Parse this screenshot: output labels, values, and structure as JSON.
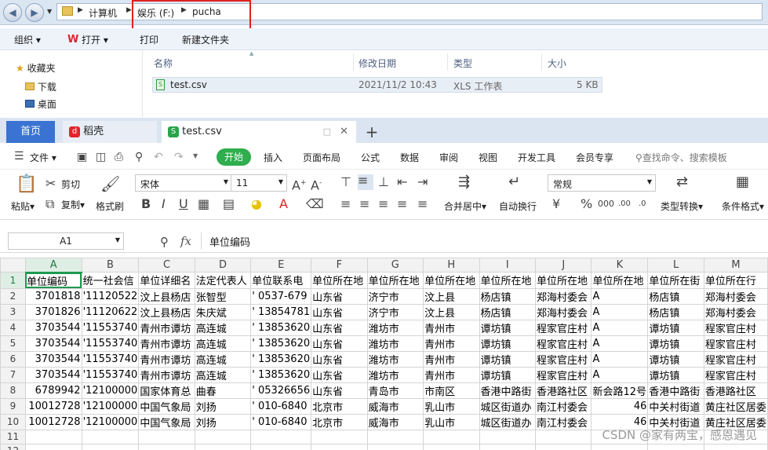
{
  "explorer": {
    "back_icon": "back-arrow-icon",
    "forward_icon": "forward-arrow-icon",
    "breadcrumb": [
      "计算机",
      "娱乐 (F:)",
      "pucha"
    ],
    "commands": [
      "组织",
      "打开",
      "打印",
      "新建文件夹"
    ],
    "nav": [
      {
        "label": "收藏夹",
        "icon": "star-icon"
      },
      {
        "label": "下载",
        "icon": "download-folder-icon"
      },
      {
        "label": "桌面",
        "icon": "desktop-icon"
      }
    ],
    "columns": [
      "名称",
      "修改日期",
      "类型",
      "大小"
    ],
    "file": {
      "name": "test.csv",
      "modified": "2021/11/2 10:43",
      "type": "XLS 工作表",
      "size": "5 KB"
    }
  },
  "wps": {
    "tabs": [
      {
        "label": "首页"
      },
      {
        "label": "稻壳"
      },
      {
        "label": "test.csv"
      }
    ],
    "add_tab": "+",
    "menu": [
      "文件",
      "开始",
      "插入",
      "页面布局",
      "公式",
      "数据",
      "审阅",
      "视图",
      "开发工具",
      "会员专享"
    ],
    "search_placeholder": "查找命令、搜索模板",
    "ribbon": {
      "paste": "粘贴",
      "cut": "剪切",
      "copy": "复制",
      "format_painter": "格式刷",
      "font_name": "宋体",
      "font_size": "11",
      "merge": "合并居中",
      "wrap": "自动换行",
      "number_format": "常规",
      "convert": "类型转换",
      "cond_format": "条件格式"
    },
    "formula": {
      "cell_ref": "A1",
      "fx": "fx",
      "content": "单位编码"
    }
  },
  "sheet": {
    "columns": [
      "A",
      "B",
      "C",
      "D",
      "E",
      "F",
      "G",
      "H",
      "I",
      "J",
      "K",
      "L",
      "M"
    ],
    "rows": [
      [
        "单位编码",
        "统一社会信",
        "单位详细名",
        "法定代表人",
        "单位联系电",
        "单位所在地",
        "单位所在地",
        "单位所在地",
        "单位所在地",
        "单位所在地",
        "单位所在地",
        "单位所在街",
        "单位所在行"
      ],
      [
        "3701818",
        "'11120522",
        "汶上县杨店",
        "张智型",
        "' 0537-679",
        "山东省",
        "济宁市",
        "汶上县",
        "杨店镇",
        "郑海村委会",
        "A",
        "杨店镇",
        "郑海村委会"
      ],
      [
        "3701826",
        "'11120622",
        "汶上县杨店",
        "朱庆斌",
        "' 13854781",
        "山东省",
        "济宁市",
        "汶上县",
        "杨店镇",
        "郑海村委会",
        "A",
        "杨店镇",
        "郑海村委会"
      ],
      [
        "3703544",
        "'11553740",
        "青州市谭坊",
        "高连城",
        "' 13853620",
        "山东省",
        "潍坊市",
        "青州市",
        "谭坊镇",
        "程家官庄村",
        "A",
        "谭坊镇",
        "程家官庄村"
      ],
      [
        "3703544",
        "'11553740",
        "青州市谭坊",
        "高连城",
        "' 13853620",
        "山东省",
        "潍坊市",
        "青州市",
        "谭坊镇",
        "程家官庄村",
        "A",
        "谭坊镇",
        "程家官庄村"
      ],
      [
        "3703544",
        "'11553740",
        "青州市谭坊",
        "高连城",
        "' 13853620",
        "山东省",
        "潍坊市",
        "青州市",
        "谭坊镇",
        "程家官庄村",
        "A",
        "谭坊镇",
        "程家官庄村"
      ],
      [
        "3703544",
        "'11553740",
        "青州市谭坊",
        "高连城",
        "' 13853620",
        "山东省",
        "潍坊市",
        "青州市",
        "谭坊镇",
        "程家官庄村",
        "A",
        "谭坊镇",
        "程家官庄村"
      ],
      [
        "6789942",
        "'12100000",
        "国家体育总",
        "曲春",
        "' 05326656",
        "山东省",
        "青岛市",
        "市南区",
        "香港中路街",
        "香港路社区",
        "新会路12号",
        "香港中路街",
        "香港路社区"
      ],
      [
        "10012728",
        "'12100000",
        "中国气象局",
        "刘扬",
        "' 010-6840",
        "北京市",
        "威海市",
        "乳山市",
        "城区街道办",
        "南江村委会",
        "46",
        "中关村街道",
        "黄庄社区居委"
      ],
      [
        "10012728",
        "'12100000",
        "中国气象局",
        "刘扬",
        "' 010-6840",
        "北京市",
        "威海市",
        "乳山市",
        "城区街道办",
        "南江村委会",
        "46",
        "中关村街道",
        "黄庄社区居委"
      ],
      [
        "",
        "",
        "",
        "",
        "",
        "",
        "",
        "",
        "",
        "",
        "",
        "",
        ""
      ],
      [
        "",
        "",
        "",
        "",
        "",
        "",
        "",
        "",
        "",
        "",
        "",
        "",
        ""
      ]
    ]
  },
  "watermark": "CSDN @家有两宝，感恩遇见"
}
